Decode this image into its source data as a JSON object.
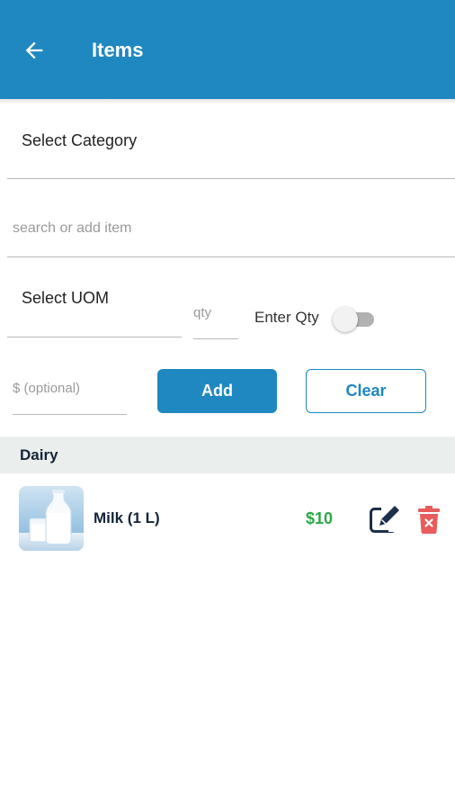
{
  "appbar": {
    "title": "Items",
    "background": "#1f88c0",
    "back_icon": "arrow-left-icon"
  },
  "form": {
    "category_label": "Select Category",
    "search_placeholder": "search or add item",
    "uom_label": "Select UOM",
    "qty_placeholder": "qty",
    "enter_qty_label": "Enter Qty",
    "enter_qty_enabled": false,
    "price_placeholder": "$ (optional)",
    "add_label": "Add",
    "clear_label": "Clear"
  },
  "sections": [
    {
      "title": "Dairy",
      "items": [
        {
          "name": "Milk (1 L)",
          "price": "$10",
          "image": "milk-bottle-photo",
          "edit_icon": "edit-icon",
          "delete_icon": "trash-icon"
        }
      ]
    }
  ],
  "colors": {
    "primary": "#1f88c0",
    "price": "#2aa845",
    "delete": "#e85c5c",
    "section_bg": "#eaeeec",
    "dark_text": "#14253b"
  }
}
